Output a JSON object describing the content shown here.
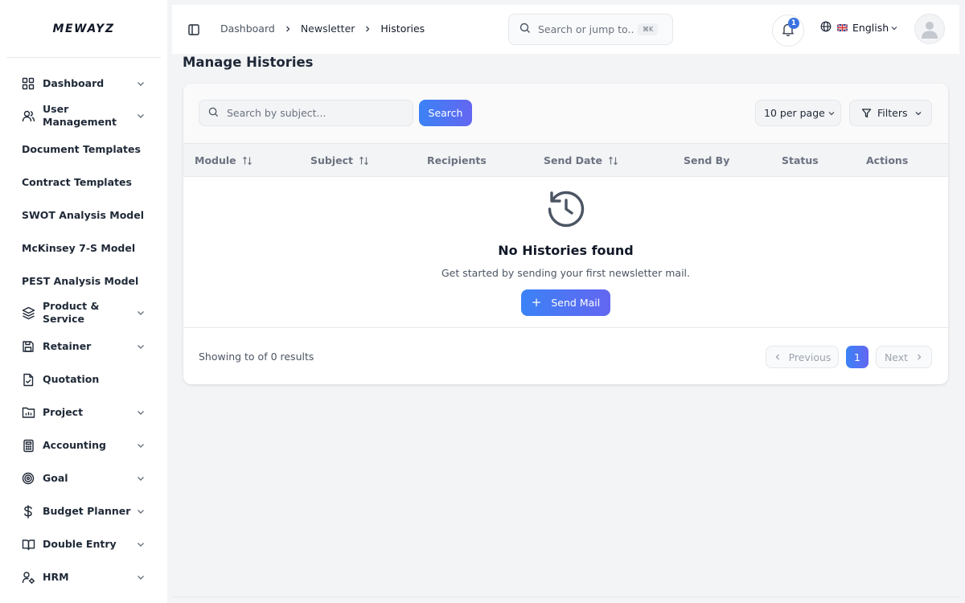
{
  "app": {
    "logo": "MEWAYZ"
  },
  "sidebar": {
    "items": [
      {
        "label": "Dashboard",
        "icon": "grid-icon",
        "has_chevron": true
      },
      {
        "label": "User\nManagement",
        "icon": "users-icon",
        "has_chevron": true
      },
      {
        "label": "Document Templates",
        "icon": "",
        "has_chevron": false
      },
      {
        "label": "Contract Templates",
        "icon": "",
        "has_chevron": false
      },
      {
        "label": "SWOT Analysis Model",
        "icon": "",
        "has_chevron": false
      },
      {
        "label": "McKinsey 7-S Model",
        "icon": "",
        "has_chevron": false
      },
      {
        "label": "PEST Analysis Model",
        "icon": "",
        "has_chevron": false
      },
      {
        "label": "Product &\nService",
        "icon": "layers-icon",
        "has_chevron": true
      },
      {
        "label": "Retainer",
        "icon": "save-icon",
        "has_chevron": true
      },
      {
        "label": "Quotation",
        "icon": "file-check-icon",
        "has_chevron": false
      },
      {
        "label": "Project",
        "icon": "folder-chart-icon",
        "has_chevron": true
      },
      {
        "label": "Accounting",
        "icon": "calculator-icon",
        "has_chevron": true
      },
      {
        "label": "Goal",
        "icon": "target-icon",
        "has_chevron": true
      },
      {
        "label": "Budget Planner",
        "icon": "dollar-icon",
        "has_chevron": true
      },
      {
        "label": "Double Entry",
        "icon": "book-icon",
        "has_chevron": true
      },
      {
        "label": "HRM",
        "icon": "user-cog-icon",
        "has_chevron": true
      }
    ]
  },
  "header": {
    "breadcrumb": [
      "Dashboard",
      "Newsletter",
      "Histories"
    ],
    "search_placeholder": "Search or jump to...",
    "search_shortcut": "⌘K",
    "notification_count": "1",
    "language": "English"
  },
  "main": {
    "title": "Manage Histories",
    "search_placeholder": "Search by subject...",
    "search_button": "Search",
    "per_page": "10 per page",
    "filters_label": "Filters",
    "columns": [
      {
        "label": "Module",
        "sortable": true
      },
      {
        "label": "Subject",
        "sortable": true
      },
      {
        "label": "Recipients",
        "sortable": false
      },
      {
        "label": "Send Date",
        "sortable": true
      },
      {
        "label": "Send By",
        "sortable": false
      },
      {
        "label": "Status",
        "sortable": false
      },
      {
        "label": "Actions",
        "sortable": false
      }
    ],
    "empty": {
      "title": "No Histories found",
      "subtitle": "Get started by sending your first newsletter mail.",
      "button": "Send Mail"
    },
    "footer": {
      "showing": "Showing to of 0 results",
      "previous": "Previous",
      "current_page": "1",
      "next": "Next"
    }
  },
  "colors": {
    "accent": "#3b82f6",
    "accent_end": "#6366f1",
    "text": "#1f2937",
    "muted": "#6b7280"
  }
}
